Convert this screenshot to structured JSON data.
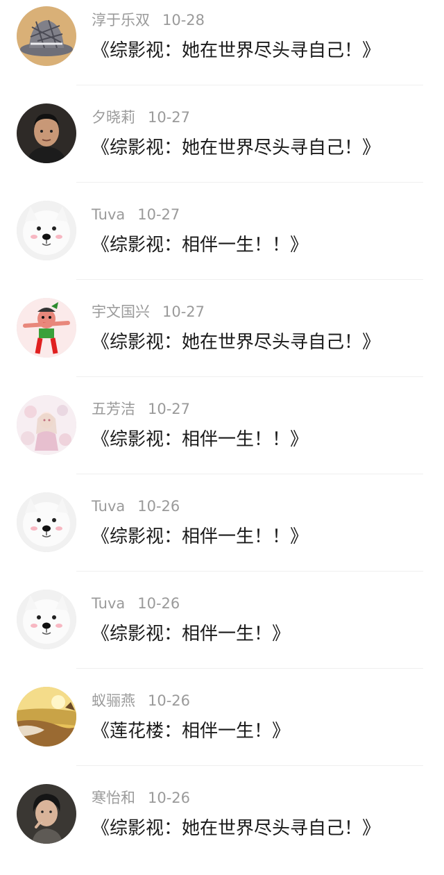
{
  "comments": [
    {
      "user": "淳于乐双",
      "date": "10-28",
      "text": "《综影视：她在世界尽头寻自己！》",
      "avatar_icon": "plaid-hat-avatar-icon"
    },
    {
      "user": "夕晓莉",
      "date": "10-27",
      "text": "《综影视：她在世界尽头寻自己！》",
      "avatar_icon": "young-man-avatar-icon"
    },
    {
      "user": "Tuva",
      "date": "10-27",
      "text": "《综影视：相伴一生！！》",
      "avatar_icon": "white-dog-avatar-icon"
    },
    {
      "user": "宇文国兴",
      "date": "10-27",
      "text": "《综影视：她在世界尽头寻自己！》",
      "avatar_icon": "cartoon-character-avatar-icon"
    },
    {
      "user": "五芳洁",
      "date": "10-27",
      "text": "《综影视：相伴一生！！》",
      "avatar_icon": "anime-illustration-avatar-icon"
    },
    {
      "user": "Tuva",
      "date": "10-26",
      "text": "《综影视：相伴一生！！》",
      "avatar_icon": "white-dog-avatar-icon"
    },
    {
      "user": "Tuva",
      "date": "10-26",
      "text": "《综影视：相伴一生！》",
      "avatar_icon": "white-dog-avatar-icon"
    },
    {
      "user": "蚁骊燕",
      "date": "10-26",
      "text": "《莲花楼：相伴一生！》",
      "avatar_icon": "beach-sunset-avatar-icon"
    },
    {
      "user": "寒怡和",
      "date": "10-26",
      "text": "《综影视：她在世界尽头寻自己！》",
      "avatar_icon": "smoking-person-avatar-icon"
    }
  ]
}
